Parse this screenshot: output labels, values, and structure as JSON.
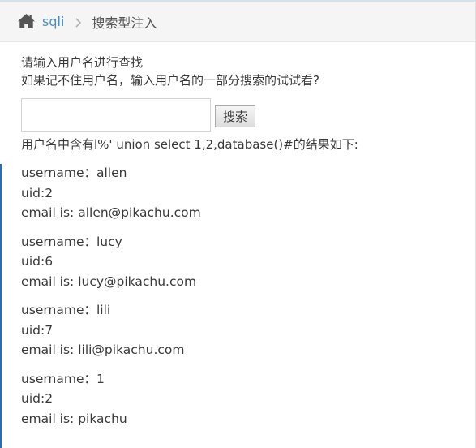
{
  "breadcrumb": {
    "home_icon": "home-icon",
    "link_label": "sqli",
    "separator_icon": "chevron-right-icon",
    "current_label": "搜索型注入"
  },
  "intro": {
    "line1": "请输入用户名进行查找",
    "line2": "如果记不住用户名，输入用户名的一部分搜索的试试看?"
  },
  "search": {
    "value": "",
    "placeholder": "",
    "button_label": "搜索"
  },
  "result_heading": "用户名中含有l%' union select 1,2,database()#的结果如下:",
  "records": [
    {
      "username": "username：allen",
      "uid": "uid:2",
      "email": "email is: allen@pikachu.com"
    },
    {
      "username": "username：lucy",
      "uid": "uid:6",
      "email": "email is: lucy@pikachu.com"
    },
    {
      "username": "username：lili",
      "uid": "uid:7",
      "email": "email is: lili@pikachu.com"
    },
    {
      "username": "username：1",
      "uid": "uid:2",
      "email": "email is: pikachu"
    }
  ],
  "colors": {
    "link": "#4c8fbd",
    "accent_rule": "#2e6ea8",
    "breadcrumb_bg": "#f5f5f5"
  }
}
